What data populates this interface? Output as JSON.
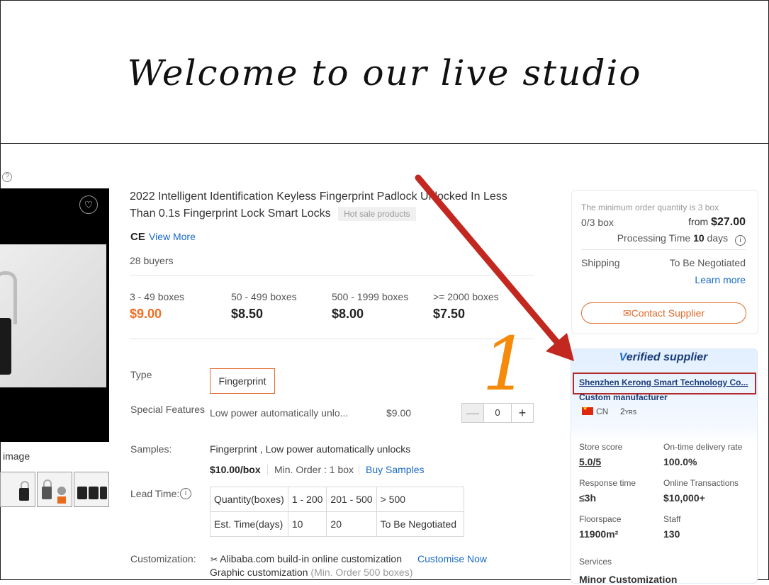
{
  "banner": {
    "title": "Welcome to our live studio"
  },
  "gallery": {
    "caption": "image",
    "thumbnails": [
      "thumb-1",
      "thumb-2",
      "thumb-3"
    ]
  },
  "product": {
    "title": "2022 Intelligent Identification Keyless Fingerprint Padlock Unlocked In Less Than 0.1s Fingerprint Lock Smart Locks",
    "hot_tag": "Hot sale products",
    "ce_mark": "CE",
    "view_more": "View More",
    "buyers": "28 buyers"
  },
  "price_tiers": [
    {
      "qty": "3 - 49 boxes",
      "price": "$9.00"
    },
    {
      "qty": "50 - 499 boxes",
      "price": "$8.50"
    },
    {
      "qty": "500 - 1999 boxes",
      "price": "$8.00"
    },
    {
      "qty": ">= 2000 boxes",
      "price": "$7.50"
    }
  ],
  "options": {
    "type_label": "Type",
    "type_value": "Fingerprint",
    "features_label": "Special Features",
    "feature_name": "Low power automatically unlo...",
    "feature_price": "$9.00",
    "quantity": "0",
    "minus": "—",
    "plus": "+"
  },
  "samples": {
    "label": "Samples:",
    "text": "Fingerprint , Low power automatically unlocks",
    "price": "$10.00/box",
    "min_order": "Min. Order : 1 box",
    "buy_label": "Buy Samples"
  },
  "lead_time": {
    "label": "Lead Time:",
    "info_icon": "i",
    "rows": [
      [
        "Quantity(boxes)",
        "1 - 200",
        "201 - 500",
        "> 500"
      ],
      [
        "Est. Time(days)",
        "10",
        "20",
        "To Be Negotiated"
      ]
    ]
  },
  "customization": {
    "label": "Customization:",
    "line1": "Alibaba.com build-in online customization",
    "link": "Customise Now",
    "line2_main": "Graphic customization",
    "line2_note": "(Min. Order 500 boxes)"
  },
  "order_card": {
    "moq_note": "The minimum order quantity is 3 box",
    "box_count": "0/3 box",
    "from_label": "from",
    "from_price": "$27.00",
    "processing_label": "Processing Time",
    "processing_days": "10",
    "processing_unit": "days",
    "info_icon": "i",
    "shipping_label": "Shipping",
    "shipping_value": "To Be Negotiated",
    "learn_more": "Learn more",
    "contact_label": "Contact Supplier"
  },
  "supplier": {
    "verified_v": "V",
    "verified_rest": "erified supplier",
    "company": "Shenzhen Kerong Smart Technology Co...",
    "type": "Custom manufacturer",
    "country": "CN",
    "years": "2",
    "years_unit": "YRS",
    "stats": [
      {
        "label": "Store score",
        "value": "5.0/5"
      },
      {
        "label": "On-time delivery rate",
        "value": "100.0%"
      },
      {
        "label": "Response time",
        "value": "≤3h"
      },
      {
        "label": "Online Transactions",
        "value": "$10,000+"
      },
      {
        "label": "Floorspace",
        "value": "11900m²"
      },
      {
        "label": "Staff",
        "value": "130"
      }
    ],
    "services_label": "Services",
    "services_cut": "Minor Customization"
  },
  "annotation": {
    "number": "1"
  },
  "colors": {
    "accent": "#f36c21",
    "link": "#1a6bc7",
    "arrow": "#c2281f",
    "annotation": "#f58a0b",
    "highlight_box": "#b02a2a"
  }
}
